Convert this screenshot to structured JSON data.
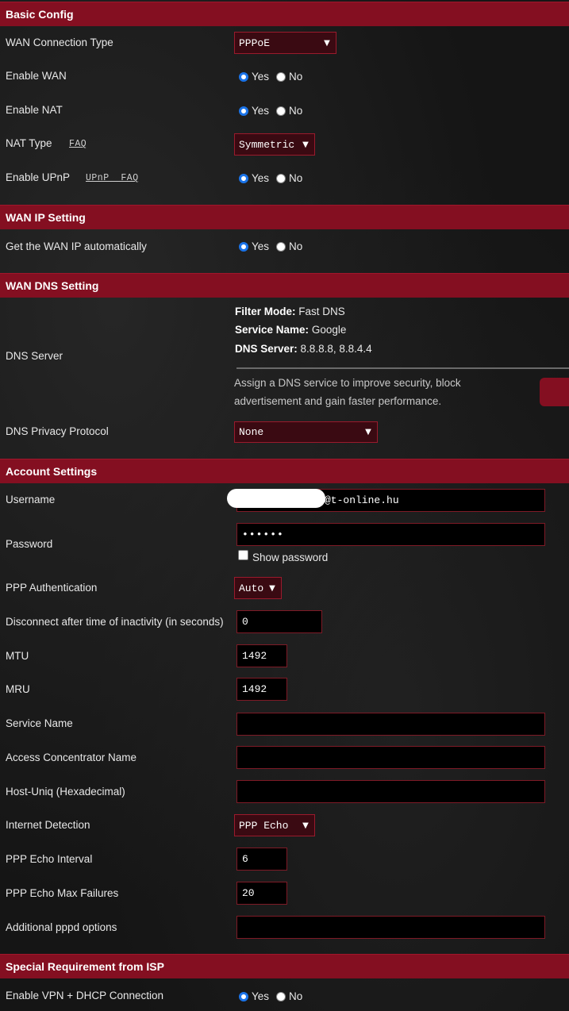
{
  "sections": {
    "basic": "Basic Config",
    "wan_ip": "WAN IP Setting",
    "wan_dns": "WAN DNS Setting",
    "account": "Account Settings",
    "special": "Special Requirement from ISP"
  },
  "radio": {
    "yes": "Yes",
    "no": "No"
  },
  "basic": {
    "wan_type_label": "WAN Connection Type",
    "wan_type_value": "PPPoE",
    "enable_wan_label": "Enable WAN",
    "enable_nat_label": "Enable NAT",
    "nat_type_label": "NAT Type",
    "nat_faq": "FAQ",
    "nat_type_value": "Symmetric",
    "upnp_label": "Enable UPnP",
    "upnp_faq": "UPnP  FAQ"
  },
  "wan_ip": {
    "auto_label": "Get the WAN IP automatically"
  },
  "dns": {
    "server_label": "DNS Server",
    "filter_key": "Filter Mode:",
    "filter_val": " Fast DNS",
    "service_key": "Service Name:",
    "service_val": " Google",
    "server_key": "DNS Server:",
    "server_val": " 8.8.8.8, 8.8.4.4",
    "assign_line1": "Assign a DNS service to improve security, block",
    "assign_line2": "advertisement and gain faster performance.",
    "privacy_label": "DNS Privacy Protocol",
    "privacy_value": "None"
  },
  "account": {
    "username_label": "Username",
    "username_value": "@t-online.hu",
    "password_label": "Password",
    "password_value": "••••••",
    "show_password": "Show password",
    "auth_label": "PPP Authentication",
    "auth_value": "Auto",
    "disconnect_label": "Disconnect after time of inactivity (in seconds)",
    "disconnect_value": "0",
    "mtu_label": "MTU",
    "mtu_value": "1492",
    "mru_label": "MRU",
    "mru_value": "1492",
    "service_name_label": "Service Name",
    "access_label": "Access Concentrator Name",
    "hostuniq_label": "Host-Uniq (Hexadecimal)",
    "detection_label": "Internet Detection",
    "detection_value": "PPP Echo",
    "echo_interval_label": "PPP Echo Interval",
    "echo_interval_value": "6",
    "echo_fail_label": "PPP Echo Max Failures",
    "echo_fail_value": "20",
    "pppd_label": "Additional pppd options"
  },
  "special": {
    "vpn_label": "Enable VPN + DHCP Connection"
  }
}
